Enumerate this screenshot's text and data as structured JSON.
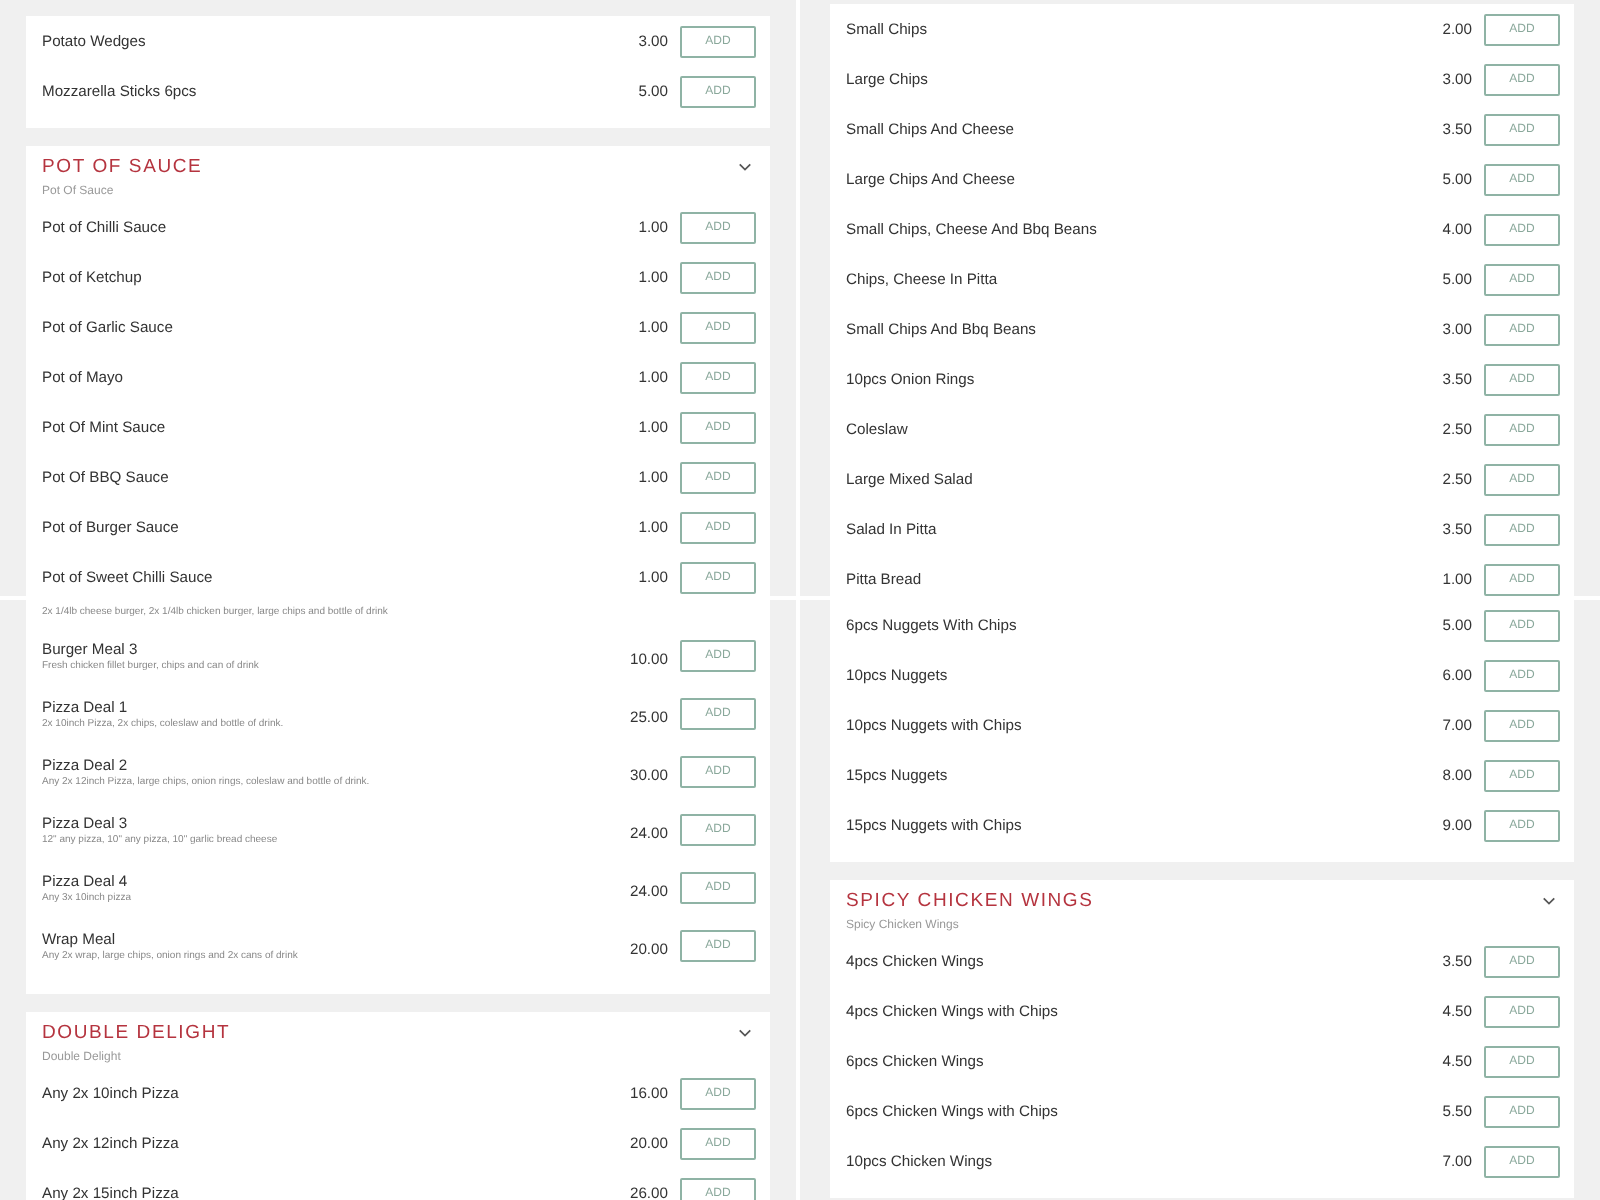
{
  "tiles": [
    {
      "cards": [
        {
          "items": [
            {
              "name": "Potato Wedges",
              "price": "3.00",
              "button": "ADD"
            },
            {
              "name": "Mozzarella Sticks 6pcs",
              "price": "5.00",
              "button": "ADD"
            }
          ]
        },
        {
          "title": "POT OF SAUCE",
          "subtitle": "Pot Of Sauce",
          "items": [
            {
              "name": "Pot of Chilli Sauce",
              "price": "1.00",
              "button": "ADD"
            },
            {
              "name": "Pot of Ketchup",
              "price": "1.00",
              "button": "ADD"
            },
            {
              "name": "Pot of Garlic Sauce",
              "price": "1.00",
              "button": "ADD"
            },
            {
              "name": "Pot of Mayo",
              "price": "1.00",
              "button": "ADD"
            },
            {
              "name": "Pot Of Mint Sauce",
              "price": "1.00",
              "button": "ADD"
            },
            {
              "name": "Pot Of BBQ Sauce",
              "price": "1.00",
              "button": "ADD"
            },
            {
              "name": "Pot of Burger Sauce",
              "price": "1.00",
              "button": "ADD"
            },
            {
              "name": "Pot of Sweet Chilli Sauce",
              "price": "1.00",
              "button": "ADD"
            }
          ]
        }
      ]
    },
    {
      "cards": [
        {
          "items": [
            {
              "name": "Small Chips",
              "price": "2.00",
              "button": "ADD"
            },
            {
              "name": "Large Chips",
              "price": "3.00",
              "button": "ADD"
            },
            {
              "name": "Small Chips And Cheese",
              "price": "3.50",
              "button": "ADD"
            },
            {
              "name": "Large Chips And Cheese",
              "price": "5.00",
              "button": "ADD"
            },
            {
              "name": "Small Chips, Cheese And Bbq Beans",
              "price": "4.00",
              "button": "ADD"
            },
            {
              "name": "Chips, Cheese In Pitta",
              "price": "5.00",
              "button": "ADD"
            },
            {
              "name": "Small Chips And Bbq Beans",
              "price": "3.00",
              "button": "ADD"
            },
            {
              "name": "10pcs Onion Rings",
              "price": "3.50",
              "button": "ADD"
            },
            {
              "name": "Coleslaw",
              "price": "2.50",
              "button": "ADD"
            },
            {
              "name": "Large Mixed Salad",
              "price": "2.50",
              "button": "ADD"
            },
            {
              "name": "Salad In Pitta",
              "price": "3.50",
              "button": "ADD"
            },
            {
              "name": "Pitta Bread",
              "price": "1.00",
              "button": "ADD"
            }
          ]
        }
      ]
    },
    {
      "cards": [
        {
          "items": [
            {
              "desc": "2x 1/4lb cheese burger, 2x 1/4lb chicken burger, large chips and bottle of drink"
            },
            {
              "name": "Burger Meal 3",
              "desc": "Fresh chicken fillet burger, chips and can of drink",
              "price": "10.00",
              "button": "ADD"
            },
            {
              "name": "Pizza Deal 1",
              "desc": "2x 10inch Pizza, 2x chips, coleslaw and bottle of drink.",
              "price": "25.00",
              "button": "ADD"
            },
            {
              "name": "Pizza Deal 2",
              "desc": "Any 2x 12inch Pizza, large chips, onion rings, coleslaw and bottle of drink.",
              "price": "30.00",
              "button": "ADD"
            },
            {
              "name": "Pizza Deal 3",
              "desc": "12\" any pizza, 10\" any pizza, 10\" garlic bread cheese",
              "price": "24.00",
              "button": "ADD"
            },
            {
              "name": "Pizza Deal 4",
              "desc": "Any 3x 10inch pizza",
              "price": "24.00",
              "button": "ADD"
            },
            {
              "name": "Wrap Meal",
              "desc": "Any 2x wrap, large chips, onion rings and 2x cans of drink",
              "price": "20.00",
              "button": "ADD"
            }
          ]
        },
        {
          "title": "DOUBLE DELIGHT",
          "subtitle": "Double Delight",
          "items": [
            {
              "name": "Any 2x 10inch Pizza",
              "price": "16.00",
              "button": "ADD"
            },
            {
              "name": "Any 2x 12inch Pizza",
              "price": "20.00",
              "button": "ADD"
            },
            {
              "name": "Any 2x 15inch Pizza",
              "price": "26.00",
              "button": "ADD"
            }
          ]
        }
      ]
    },
    {
      "cards": [
        {
          "items": [
            {
              "name": "6pcs Nuggets With Chips",
              "price": "5.00",
              "button": "ADD"
            },
            {
              "name": "10pcs Nuggets",
              "price": "6.00",
              "button": "ADD"
            },
            {
              "name": "10pcs Nuggets with Chips",
              "price": "7.00",
              "button": "ADD"
            },
            {
              "name": "15pcs Nuggets",
              "price": "8.00",
              "button": "ADD"
            },
            {
              "name": "15pcs Nuggets with Chips",
              "price": "9.00",
              "button": "ADD"
            }
          ]
        },
        {
          "title": "SPICY CHICKEN WINGS",
          "subtitle": "Spicy Chicken Wings",
          "items": [
            {
              "name": "4pcs Chicken Wings",
              "price": "3.50",
              "button": "ADD"
            },
            {
              "name": "4pcs Chicken Wings with Chips",
              "price": "4.50",
              "button": "ADD"
            },
            {
              "name": "6pcs Chicken Wings",
              "price": "4.50",
              "button": "ADD"
            },
            {
              "name": "6pcs Chicken Wings with Chips",
              "price": "5.50",
              "button": "ADD"
            },
            {
              "name": "10pcs Chicken Wings",
              "price": "7.00",
              "button": "ADD"
            }
          ]
        }
      ]
    }
  ]
}
